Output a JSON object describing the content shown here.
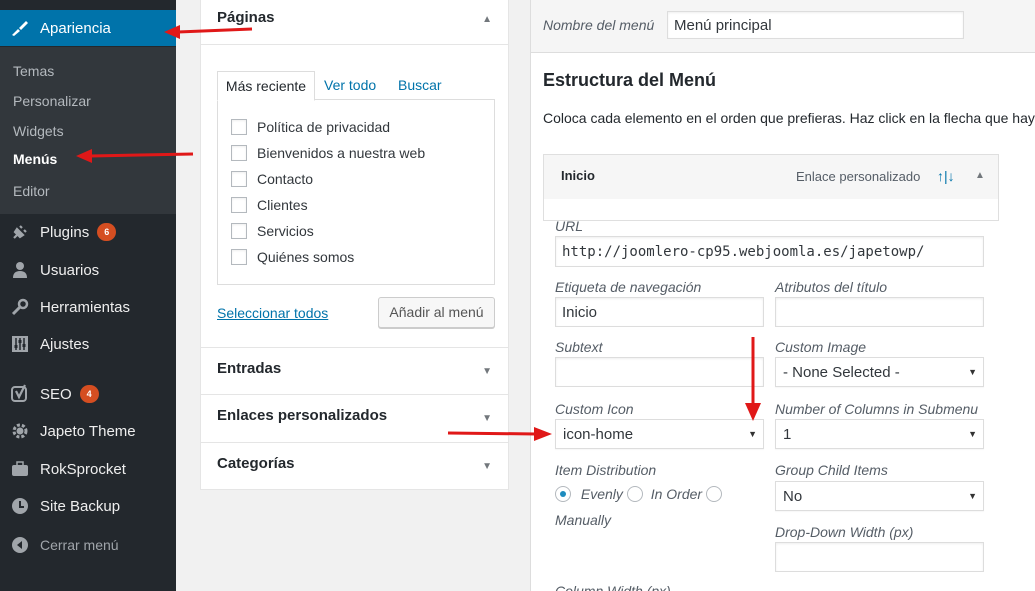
{
  "sidebar": {
    "appearance": "Apariencia",
    "submenu": [
      "Temas",
      "Personalizar",
      "Widgets",
      "Menús",
      "Editor"
    ],
    "plugins": "Plugins",
    "plugins_count": "6",
    "users": "Usuarios",
    "tools": "Herramientas",
    "settings": "Ajustes",
    "seo": "SEO",
    "seo_count": "4",
    "japeto_theme": "Japeto Theme",
    "roksprocket": "RokSprocket",
    "site_backup": "Site Backup",
    "collapse": "Cerrar menú"
  },
  "accordion": {
    "pages_title": "Páginas",
    "tabs": [
      "Más reciente",
      "Ver todo",
      "Buscar"
    ],
    "pages": [
      "Política de privacidad",
      "Bienvenidos a nuestra web",
      "Contacto",
      "Clientes",
      "Servicios",
      "Quiénes somos"
    ],
    "select_all": "Seleccionar todos",
    "add_to_menu": "Añadir al menú",
    "posts_title": "Entradas",
    "custom_links_title": "Enlaces personalizados",
    "categories_title": "Categorías"
  },
  "menu": {
    "name_label": "Nombre del menú",
    "name_value": "Menú principal",
    "structure_title": "Estructura del Menú",
    "structure_desc": "Coloca cada elemento en el orden que prefieras. Haz click en la flecha que hay",
    "item_title": "Inicio",
    "item_type": "Enlace personalizado",
    "item_order": "↑|↓"
  },
  "item_settings": {
    "url_label": "URL",
    "url_value": "http://joomlero-cp95.webjoomla.es/japetowp/",
    "nav_label": "Etiqueta de navegación",
    "nav_value": "Inicio",
    "title_attr_label": "Atributos del título",
    "title_attr_value": "",
    "subtext_label": "Subtext",
    "subtext_value": "",
    "custom_image_label": "Custom Image",
    "custom_image_value": "- None Selected -",
    "custom_icon_label": "Custom Icon",
    "custom_icon_value": "icon-home",
    "columns_label": "Number of Columns in Submenu",
    "columns_value": "1",
    "distribution_label": "Item Distribution",
    "distribution_options": [
      "Evenly",
      "In Order",
      "Manually"
    ],
    "distribution_selected": "Evenly",
    "group_label": "Group Child Items",
    "group_value": "No",
    "dropdown_width_label": "Drop-Down Width (px)",
    "dropdown_width_value": "",
    "column_width_label": "Column Width (px)"
  },
  "colors": {
    "sidebar_bg": "#23282d",
    "active_bg": "#0073aa",
    "badge": "#d54e21",
    "annotation_arrow": "#e01818"
  }
}
